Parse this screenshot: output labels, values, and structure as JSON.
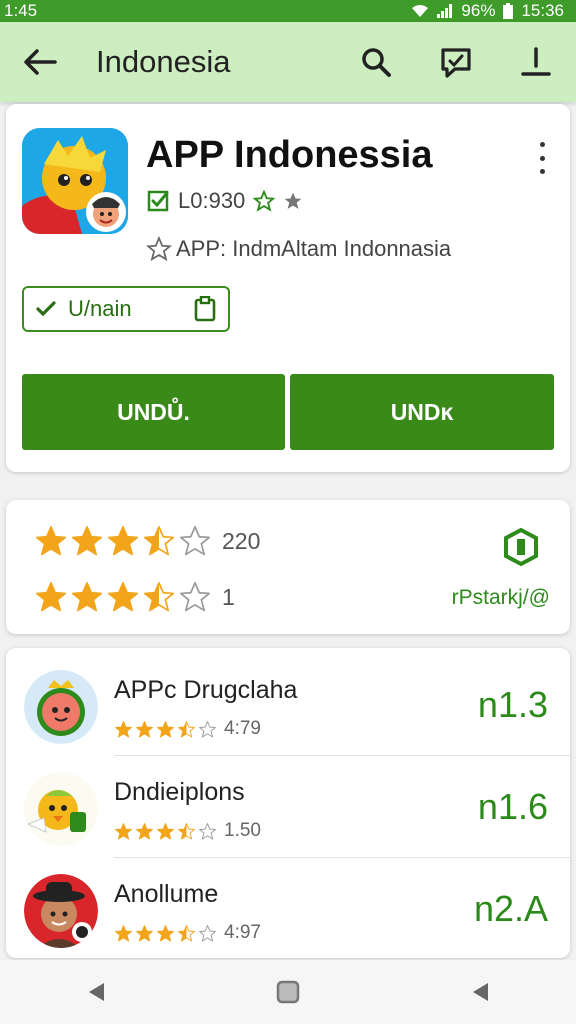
{
  "status": {
    "time_left": "1:45",
    "battery": "96%",
    "time_right": "15:36",
    "bar_color": "#3f9b2a"
  },
  "appbar": {
    "title": "Indonesia",
    "bg_color": "#cdeec0"
  },
  "app": {
    "title": "APP Indonessia",
    "meta1": "L0:930",
    "meta2": "APP: IndmAltam Indonnasia",
    "chip_label": "U/nain",
    "button_left": "UNDŮ.",
    "button_right": "UNDĸ"
  },
  "ratings": {
    "row1_stars": 3.5,
    "row1_count": "220",
    "row2_stars": 3.5,
    "row2_count": "1",
    "link_label": "rPstarkj/@"
  },
  "list": [
    {
      "name": "APPc Drugclaha",
      "stars": 3.5,
      "rating": "4:79",
      "price": "n1.3",
      "icon": "watermelon-avatar"
    },
    {
      "name": "Dndieiplons",
      "stars": 3.5,
      "rating": "1.50",
      "price": "n1.6",
      "icon": "duck-avatar"
    },
    {
      "name": "Anollume",
      "stars": 3.5,
      "rating": "4:97",
      "price": "n2.A",
      "icon": "person-hat-avatar"
    }
  ],
  "colors": {
    "accent_green": "#3a8a1a",
    "star_gold": "#f2a51a"
  }
}
